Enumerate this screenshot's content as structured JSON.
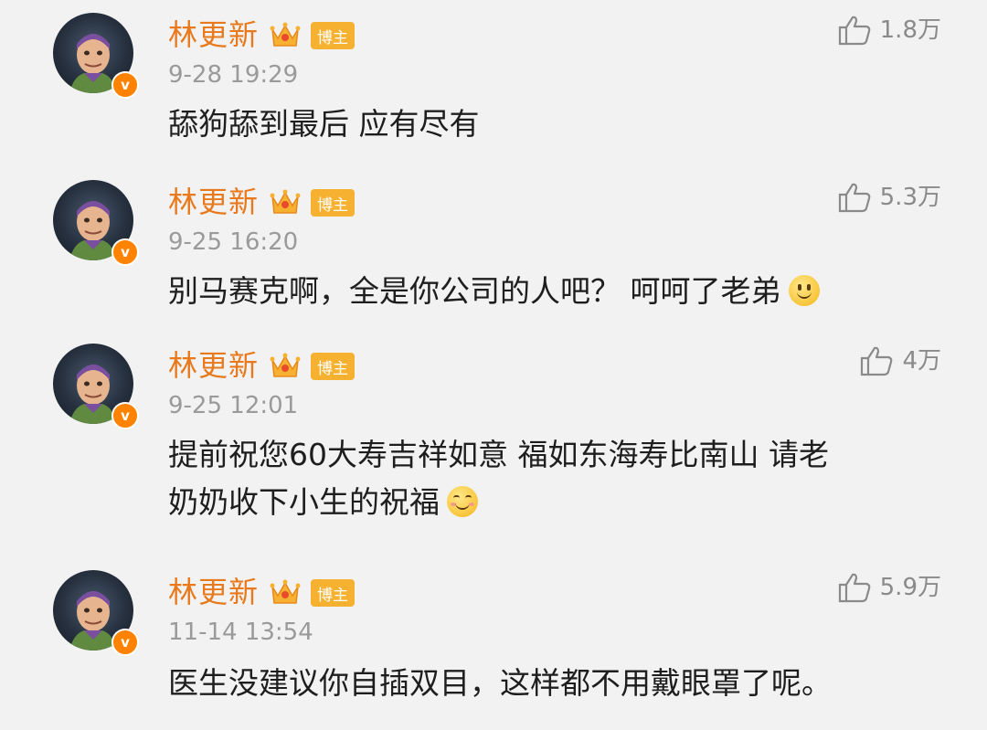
{
  "tag_label": "博主",
  "comments": [
    {
      "author": "林更新",
      "time": "9-28 19:29",
      "likes": "1.8万",
      "text": "舔狗舔到最后 应有尽有"
    },
    {
      "author": "林更新",
      "time": "9-25 16:20",
      "likes": "5.3万",
      "text": "别马赛克啊，全是你公司的人吧？ 呵呵了老弟",
      "emoji": "smile-emoji"
    },
    {
      "author": "林更新",
      "time": "9-25 12:01",
      "likes": "4万",
      "text_line1": "提前祝您60大寿吉祥如意 福如东海寿比南山  请老",
      "text_line2": "奶奶收下小生的祝福",
      "emoji": "blush-smile-emoji"
    },
    {
      "author": "林更新",
      "time": "11-14 13:54",
      "likes": "5.9万",
      "text": "医生没建议你自插双目，这样都不用戴眼罩了呢。"
    }
  ],
  "verified_mark": "v",
  "colors": {
    "author_name": "#e8791c",
    "tag_bg": "#f7b131",
    "verified_badge": "#ff8200",
    "timestamp": "#9a9a9a",
    "like_count": "#8a8a8a",
    "background": "#f2f2f2"
  },
  "icons": [
    "thumbs-up-icon",
    "crown-icon",
    "verified-badge-icon",
    "smile-emoji",
    "blush-smile-emoji"
  ]
}
